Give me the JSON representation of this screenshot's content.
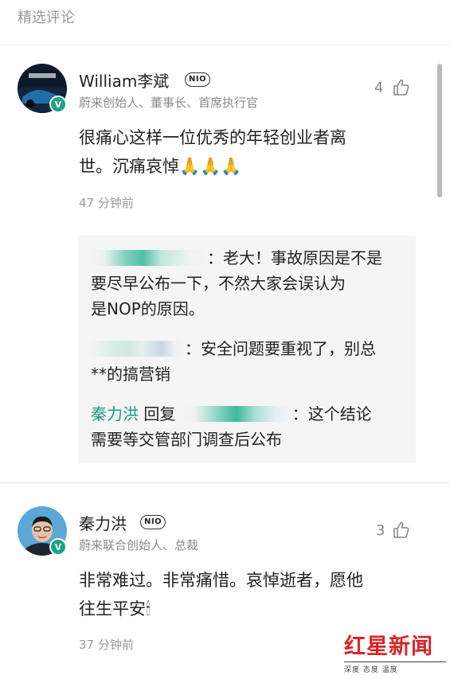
{
  "header": {
    "title": "精选评论"
  },
  "comments": [
    {
      "name": "William李斌",
      "badge": "NIO",
      "title": "蔚来创始人、董事长、首席执行官",
      "likes": "4",
      "content_line1": "很痛心这样一位优秀的年轻创业者离",
      "content_line2": "世。沉痛哀悼🙏🙏🙏",
      "time": "47 分钟前",
      "replies": [
        {
          "text_line1": "：老大！事故原因是不是",
          "text_line2": "要尽早公布一下，不然大家会误认为",
          "text_line3": "是NOP的原因。"
        },
        {
          "text_line1": "：安全问题要重视了，别总",
          "text_line2": "**的搞营销"
        },
        {
          "author": "秦力洪",
          "action": " 回复 ",
          "text_line1": "：这个结论",
          "text_line2": "需要等交管部门调查后公布"
        }
      ]
    },
    {
      "name": "秦力洪",
      "badge": "NIO",
      "title": "蔚来联合创始人、总裁",
      "likes": "3",
      "content_line1": "非常难过。非常痛惜。哀悼逝者，愿他",
      "content_line2": "往生平安🕯",
      "time": "37 分钟前"
    }
  ],
  "watermark": {
    "logo": "红星新闻",
    "tagline": "深度 态度 温度"
  },
  "colors": {
    "author": "#1a9c84",
    "verified": "#1aa386",
    "logo": "#d9252a"
  }
}
